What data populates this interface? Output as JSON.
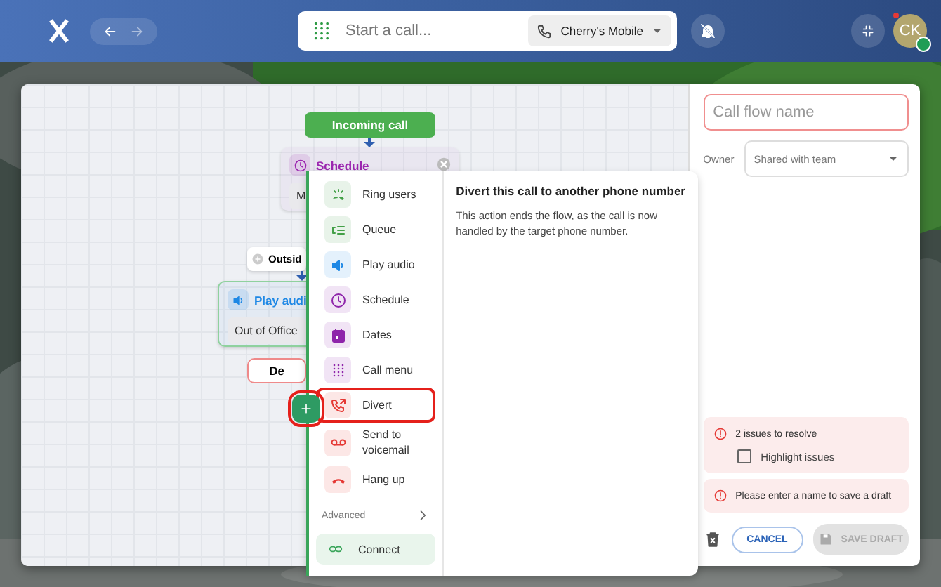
{
  "topbar": {
    "nav": {
      "back": {
        "disabled": false
      },
      "forward": {
        "disabled": true
      }
    },
    "search": {
      "placeholder": "Start a call..."
    },
    "line_selector": "Cherry's Mobile",
    "notifications_muted": true,
    "avatar": {
      "initials": "CK",
      "online": true,
      "notification": true
    }
  },
  "canvas": {
    "nodes": [
      {
        "kind": "trigger",
        "label": "Incoming call"
      },
      {
        "kind": "step",
        "label": "Schedule",
        "color": "#9c27b0",
        "chip": "M"
      },
      {
        "kind": "branch",
        "label": "Outsid"
      },
      {
        "kind": "step",
        "label": "Play audi",
        "color": "#1e88e5",
        "chip": "Out of Office"
      },
      {
        "kind": "empty",
        "label": "De"
      }
    ],
    "add_button": {
      "highlighted": true
    }
  },
  "menu": {
    "items": [
      {
        "label": "Ring users",
        "color": "#43a047",
        "selected": false
      },
      {
        "label": "Queue",
        "color": "#43a047",
        "selected": false
      },
      {
        "label": "Play audio",
        "color": "#1e88e5",
        "selected": false
      },
      {
        "label": "Schedule",
        "color": "#8e24aa",
        "selected": false
      },
      {
        "label": "Dates",
        "color": "#8e24aa",
        "selected": false
      },
      {
        "label": "Call menu",
        "color": "#8e24aa",
        "selected": false
      },
      {
        "label": "Divert",
        "color": "#e53935",
        "selected": true
      },
      {
        "label": "Send to voicemail",
        "color": "#e53935",
        "selected": false
      },
      {
        "label": "Hang up",
        "color": "#e53935",
        "selected": false
      }
    ],
    "advanced": "Advanced",
    "connect": "Connect",
    "detail": {
      "title": "Divert this call to another phone number",
      "body": "This action ends the flow, as the call is now handled by the target phone number."
    }
  },
  "panel": {
    "name_field": {
      "placeholder": "Call flow name",
      "invalid": true
    },
    "owner": {
      "label": "Owner",
      "value": "Shared with team"
    },
    "issues": {
      "title": "2 issues to resolve",
      "checkbox": {
        "label": "Highlight issues",
        "checked": false
      }
    },
    "error": "Please enter a name to save a draft",
    "cancel": "CANCEL",
    "save": {
      "label": "SAVE DRAFT",
      "disabled": true
    }
  }
}
